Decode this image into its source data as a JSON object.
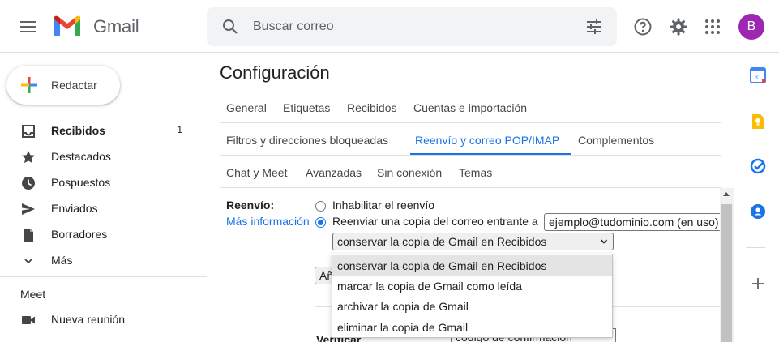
{
  "app": {
    "name": "Gmail"
  },
  "search": {
    "placeholder": "Buscar correo"
  },
  "account": {
    "initial": "B",
    "color": "#9c27b0"
  },
  "compose": {
    "label": "Redactar"
  },
  "nav": {
    "items": [
      {
        "label": "Recibidos",
        "count": "1",
        "icon": "inbox-icon"
      },
      {
        "label": "Destacados",
        "count": "",
        "icon": "star-icon"
      },
      {
        "label": "Pospuestos",
        "count": "",
        "icon": "clock-icon"
      },
      {
        "label": "Enviados",
        "count": "",
        "icon": "send-icon"
      },
      {
        "label": "Borradores",
        "count": "",
        "icon": "draft-icon"
      },
      {
        "label": "Más",
        "count": "",
        "icon": "chevron-down-icon"
      }
    ],
    "meet_title": "Meet",
    "meet_items": [
      {
        "label": "Nueva reunión",
        "icon": "video-icon"
      }
    ]
  },
  "settings": {
    "title": "Configuración",
    "tabs_row1": [
      "General",
      "Etiquetas",
      "Recibidos",
      "Cuentas e importación"
    ],
    "tabs_row2": [
      "Filtros y direcciones bloqueadas",
      "Reenvío y correo POP/IMAP",
      "Complementos"
    ],
    "tabs_row3": [
      "Chat y Meet",
      "Avanzadas",
      "Sin conexión",
      "Temas"
    ],
    "active_tab": "Reenvío y correo POP/IMAP",
    "forwarding": {
      "label": "Reenvío:",
      "more_info": "Más información",
      "option_disable": "Inhabilitar el reenvío",
      "option_forward": "Reenviar una copia del correo entrante a",
      "forward_email": "ejemplo@tudominio.com (en uso)",
      "copy_action_selected": "conservar la copia de Gmail en Recibidos",
      "copy_action_options": [
        "conservar la copia de Gmail en Recibidos",
        "marcar la copia de Gmail como leída",
        "archivar la copia de Gmail",
        "eliminar la copia de Gmail"
      ],
      "add_button_partial": "Añadir una dirección de reenvío",
      "verify_partial": "Verificar",
      "code_partial": "código de confirmación"
    }
  },
  "colors": {
    "accent": "#1a73e8",
    "text": "#202124",
    "muted": "#5f6368"
  }
}
